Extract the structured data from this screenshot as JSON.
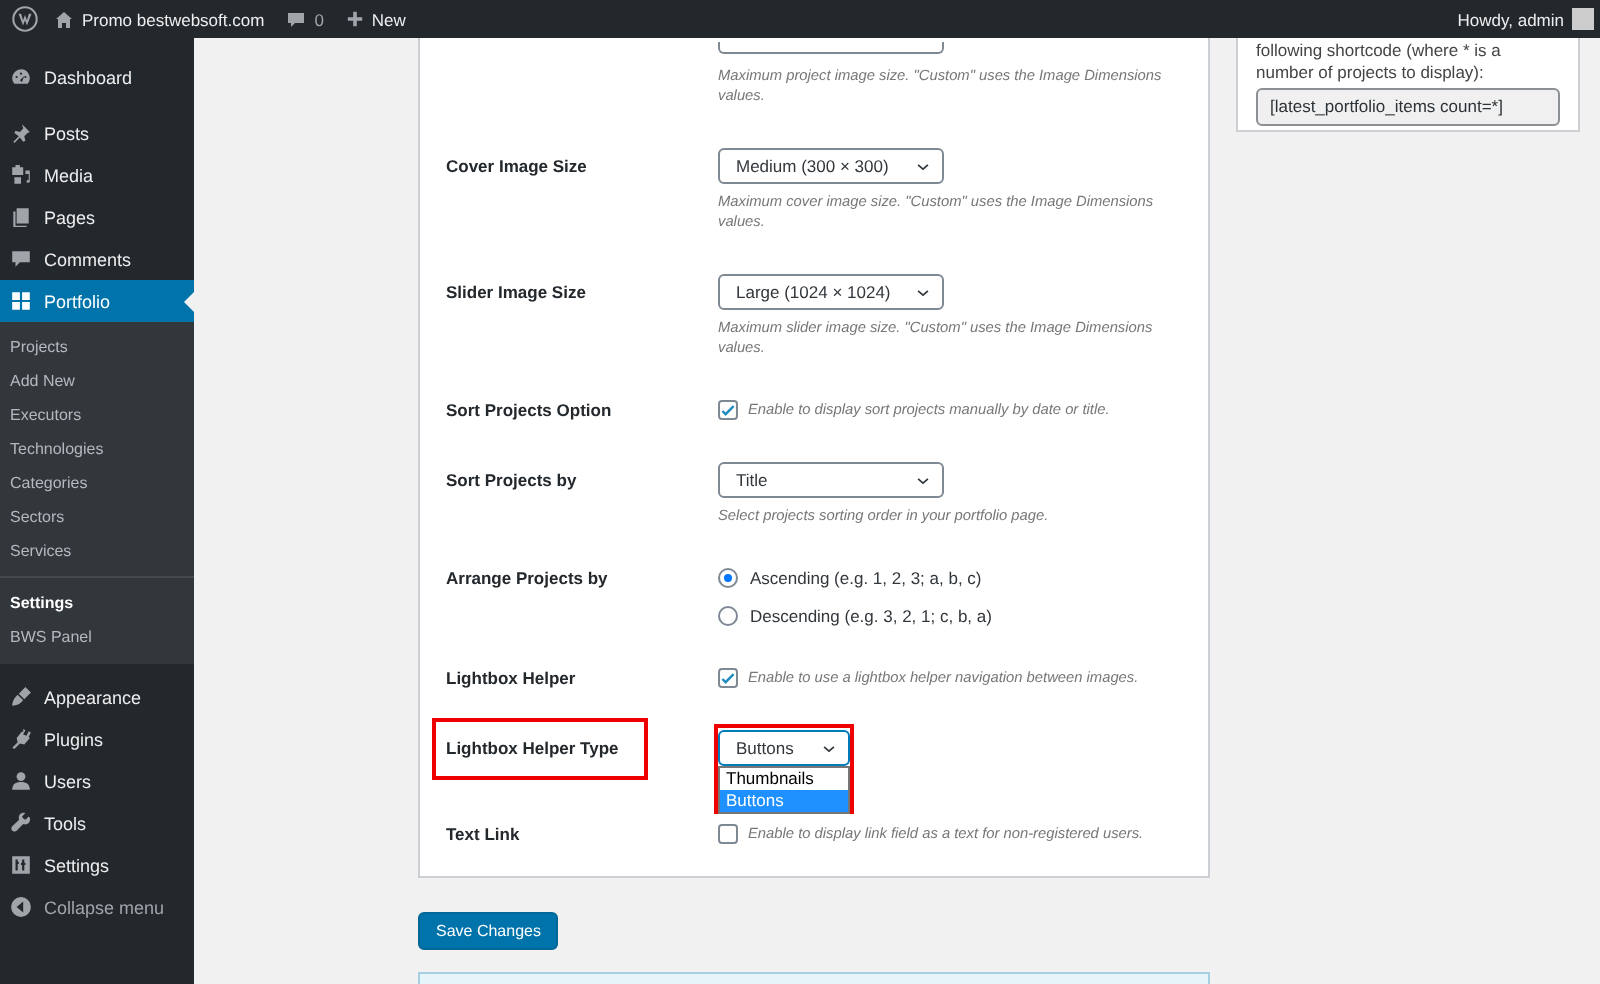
{
  "admin_bar": {
    "site_name": "Promo bestwebsoft.com",
    "comments_count": "0",
    "new_label": "New",
    "greeting": "Howdy, admin"
  },
  "sidebar": {
    "items": [
      {
        "label": "Dashboard",
        "selected": false
      },
      {
        "label": "Posts",
        "selected": false
      },
      {
        "label": "Media",
        "selected": false
      },
      {
        "label": "Pages",
        "selected": false
      },
      {
        "label": "Comments",
        "selected": false
      },
      {
        "label": "Portfolio",
        "selected": true,
        "submenu_groups": [
          [
            {
              "label": "Projects",
              "selected": false
            },
            {
              "label": "Add New",
              "selected": false
            },
            {
              "label": "Executors",
              "selected": false
            },
            {
              "label": "Technologies",
              "selected": false
            },
            {
              "label": "Categories",
              "selected": false
            },
            {
              "label": "Sectors",
              "selected": false
            },
            {
              "label": "Services",
              "selected": false
            }
          ],
          [
            {
              "label": "Settings",
              "selected": true
            },
            {
              "label": "BWS Panel",
              "selected": false
            }
          ]
        ]
      },
      {
        "label": "Appearance",
        "selected": false
      },
      {
        "label": "Plugins",
        "selected": false
      },
      {
        "label": "Users",
        "selected": false
      },
      {
        "label": "Tools",
        "selected": false
      },
      {
        "label": "Settings",
        "selected": false
      }
    ],
    "collapse_label": "Collapse menu"
  },
  "settings": {
    "rows": [
      {
        "kind": "select",
        "description": "Maximum project image size. \"Custom\" uses the Image Dimensions values."
      },
      {
        "kind": "select",
        "label": "Cover Image Size",
        "value": "Medium (300 × 300)",
        "description": "Maximum cover image size. \"Custom\" uses the Image Dimensions values."
      },
      {
        "kind": "select",
        "label": "Slider Image Size",
        "value": "Large (1024 × 1024)",
        "description": "Maximum slider image size. \"Custom\" uses the Image Dimensions values."
      },
      {
        "kind": "checkbox",
        "label": "Sort Projects Option",
        "checked": true,
        "description": "Enable to display sort projects manually by date or title."
      },
      {
        "kind": "select",
        "label": "Sort Projects by",
        "value": "Title",
        "description": "Select projects sorting order in your portfolio page."
      },
      {
        "kind": "radio",
        "label": "Arrange Projects by",
        "options": [
          {
            "label": "Ascending (e.g. 1, 2, 3; a, b, c)",
            "selected": true
          },
          {
            "label": "Descending (e.g. 3, 2, 1; c, b, a)",
            "selected": false
          }
        ]
      },
      {
        "kind": "checkbox",
        "label": "Lightbox Helper",
        "checked": true,
        "description": "Enable to use a lightbox helper navigation between images."
      },
      {
        "kind": "select",
        "label": "Lightbox Helper Type",
        "value": "Buttons",
        "expanded": true,
        "highlighted": true,
        "options": [
          {
            "label": "Thumbnails",
            "selected": false
          },
          {
            "label": "Buttons",
            "selected": true
          }
        ]
      },
      {
        "kind": "checkbox",
        "label": "Text Link",
        "checked": false,
        "description": "Enable to display link field as a text for non-registered users."
      }
    ]
  },
  "save_button": "Save Changes",
  "shortcode_widget": {
    "text": "following shortcode (where * is a number of projects to display):",
    "value": "[latest_portfolio_items count=*]"
  }
}
